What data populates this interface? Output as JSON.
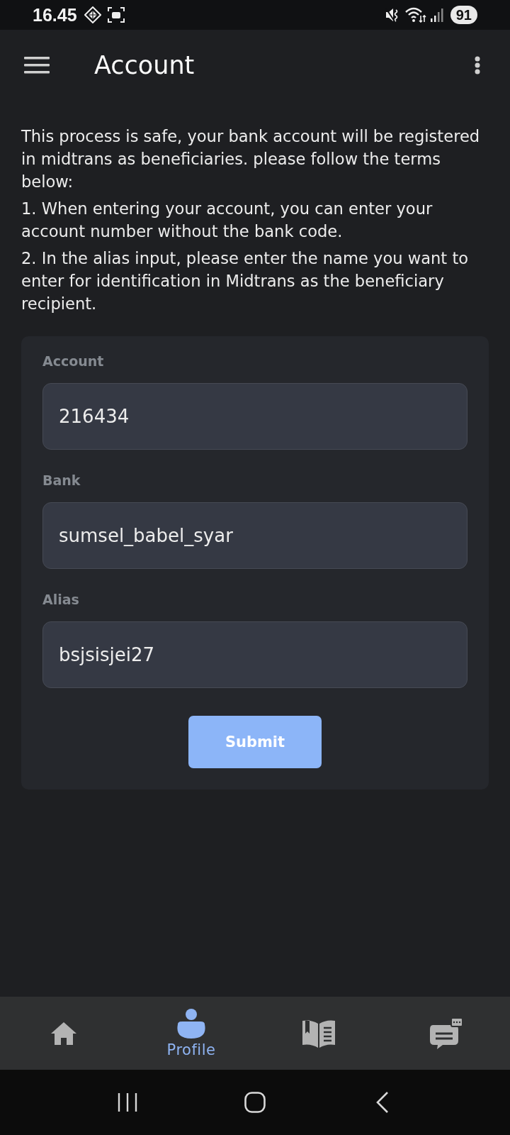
{
  "status_bar": {
    "time": "16.45",
    "battery": "91"
  },
  "app_bar": {
    "title": "Account"
  },
  "intro": {
    "text": "This process is safe, your bank account will be registered in midtrans as beneficiaries. please follow the terms below:",
    "terms": [
      "1. When entering your account, you can enter your account number without the bank code.",
      "2. In the alias input, please enter the name you want to enter for identification in Midtrans as the beneficiary recipient."
    ]
  },
  "form": {
    "fields": [
      {
        "label": "Account",
        "value": "216434"
      },
      {
        "label": "Bank",
        "value": "sumsel_babel_syar"
      },
      {
        "label": "Alias",
        "value": "bsjsisjei27"
      }
    ],
    "submit": "Submit"
  },
  "bottom_nav": [
    {
      "kind": "home",
      "selected": false
    },
    {
      "kind": "profile",
      "label": "Profile",
      "selected": true
    },
    {
      "kind": "book",
      "selected": false
    },
    {
      "kind": "chat",
      "selected": false
    }
  ]
}
